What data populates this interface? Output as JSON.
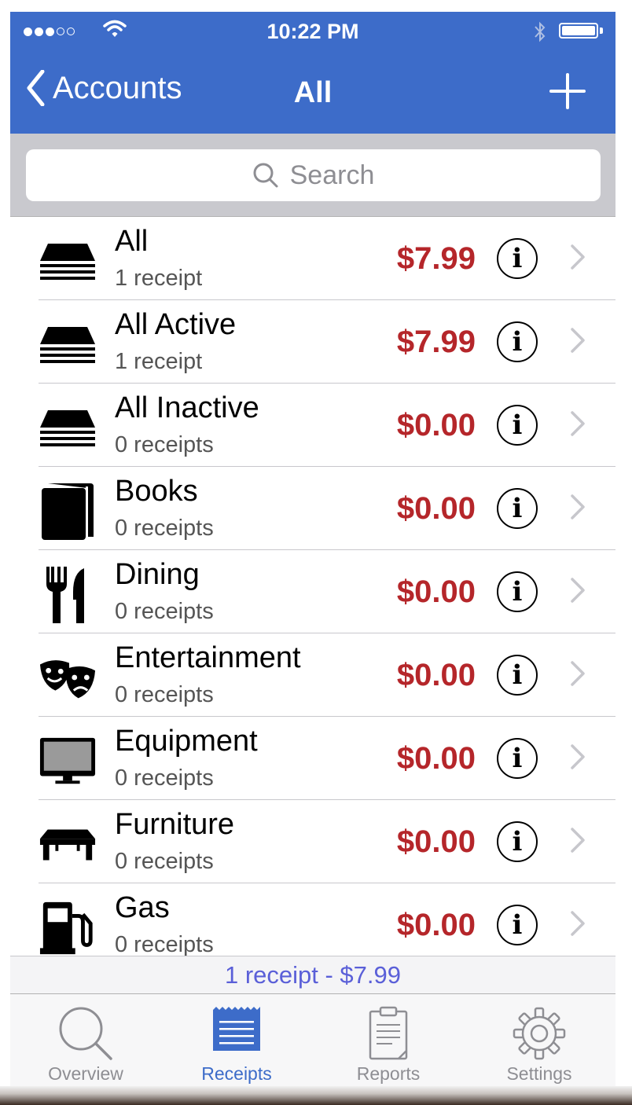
{
  "status_bar": {
    "time": "10:22 PM",
    "signal_icon": "signal-dots-icon",
    "wifi_icon": "wifi-icon",
    "bluetooth_icon": "bluetooth-icon",
    "battery_icon": "battery-full-icon"
  },
  "nav": {
    "back_label": "Accounts",
    "title": "All",
    "add_icon": "plus-icon"
  },
  "search": {
    "placeholder": "Search",
    "icon": "magnifier-icon"
  },
  "accounts": [
    {
      "name": "All",
      "count": "1 receipt",
      "amount": "$7.99",
      "icon": "stack-icon"
    },
    {
      "name": "All Active",
      "count": "1 receipt",
      "amount": "$7.99",
      "icon": "stack-icon"
    },
    {
      "name": "All Inactive",
      "count": "0 receipts",
      "amount": "$0.00",
      "icon": "stack-icon"
    },
    {
      "name": "Books",
      "count": "0 receipts",
      "amount": "$0.00",
      "icon": "book-icon"
    },
    {
      "name": "Dining",
      "count": "0 receipts",
      "amount": "$0.00",
      "icon": "fork-knife-icon"
    },
    {
      "name": "Entertainment",
      "count": "0 receipts",
      "amount": "$0.00",
      "icon": "theater-masks-icon"
    },
    {
      "name": "Equipment",
      "count": "0 receipts",
      "amount": "$0.00",
      "icon": "monitor-icon"
    },
    {
      "name": "Furniture",
      "count": "0 receipts",
      "amount": "$0.00",
      "icon": "table-icon"
    },
    {
      "name": "Gas",
      "count": "0 receipts",
      "amount": "$0.00",
      "icon": "gas-pump-icon"
    }
  ],
  "info_glyph": "i",
  "summary": "1 receipt - $7.99",
  "tabs": [
    {
      "label": "Overview",
      "icon": "magnifier-icon",
      "active": false
    },
    {
      "label": "Receipts",
      "icon": "receipts-icon",
      "active": true
    },
    {
      "label": "Reports",
      "icon": "clipboard-icon",
      "active": false
    },
    {
      "label": "Settings",
      "icon": "gear-icon",
      "active": false
    }
  ],
  "colors": {
    "nav_bar": "#3d6cc9",
    "amount": "#b5262a",
    "summary_text": "#5a5fd8",
    "active_tab": "#3d6cc9",
    "inactive_tab": "#8e8e93"
  }
}
